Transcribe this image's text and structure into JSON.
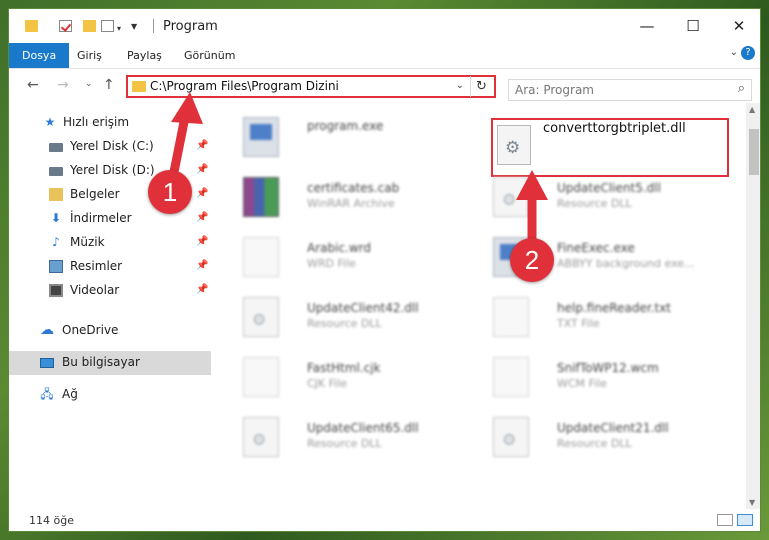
{
  "window": {
    "title": "Program"
  },
  "ribbon": {
    "tabs": [
      {
        "label": "Dosya",
        "active": true
      },
      {
        "label": "Giriş"
      },
      {
        "label": "Paylaş"
      },
      {
        "label": "Görünüm"
      }
    ],
    "help_label": "?"
  },
  "nav": {
    "address": "C:\\Program Files\\Program Dizini",
    "search_placeholder": "Ara: Program"
  },
  "sidebar": {
    "items": [
      {
        "label": "Hızlı erişim",
        "icon": "star-icon"
      },
      {
        "label": "Yerel Disk (C:)",
        "icon": "drive-icon",
        "pinned": true
      },
      {
        "label": "Yerel Disk (D:)",
        "icon": "drive-icon",
        "pinned": true
      },
      {
        "label": "Belgeler",
        "icon": "documents-icon",
        "pinned": true
      },
      {
        "label": "İndirmeler",
        "icon": "download-icon",
        "pinned": true
      },
      {
        "label": "Müzik",
        "icon": "music-icon",
        "pinned": true
      },
      {
        "label": "Resimler",
        "icon": "pictures-icon",
        "pinned": true
      },
      {
        "label": "Videolar",
        "icon": "videos-icon",
        "pinned": true
      },
      {
        "label": "OneDrive",
        "icon": "cloud-icon"
      },
      {
        "label": "Bu bilgisayar",
        "icon": "computer-icon",
        "selected": true
      },
      {
        "label": "Ağ",
        "icon": "network-icon"
      }
    ]
  },
  "files": [
    {
      "name": "program.exe",
      "type": "",
      "icon": "exe-icon"
    },
    {
      "name": "converttorgbtriplet.dll",
      "type": "",
      "icon": "dll-icon",
      "highlighted": true
    },
    {
      "name": "certificates.cab",
      "type": "WinRAR Archive",
      "icon": "rar-icon"
    },
    {
      "name": "UpdateClient5.dll",
      "type": "Resource DLL",
      "icon": "dll-icon"
    },
    {
      "name": "Arabic.wrd",
      "type": "WRD File",
      "icon": "file-icon"
    },
    {
      "name": "FineExec.exe",
      "type": "ABBYY background exe...",
      "icon": "exe-icon"
    },
    {
      "name": "UpdateClient42.dll",
      "type": "Resource DLL",
      "icon": "dll-icon"
    },
    {
      "name": "help.fineReader.txt",
      "type": "TXT File",
      "icon": "text-icon"
    },
    {
      "name": "FastHtml.cjk",
      "type": "CJK File",
      "icon": "file-icon"
    },
    {
      "name": "SnifToWP12.wcm",
      "type": "WCM File",
      "icon": "file-icon"
    },
    {
      "name": "UpdateClient65.dll",
      "type": "Resource DLL",
      "icon": "dll-icon"
    },
    {
      "name": "UpdateClient21.dll",
      "type": "Resource DLL",
      "icon": "dll-icon"
    }
  ],
  "status": {
    "count": "114 öğe"
  },
  "annotations": {
    "step1": "1",
    "step2": "2",
    "color": "#e0303a"
  }
}
